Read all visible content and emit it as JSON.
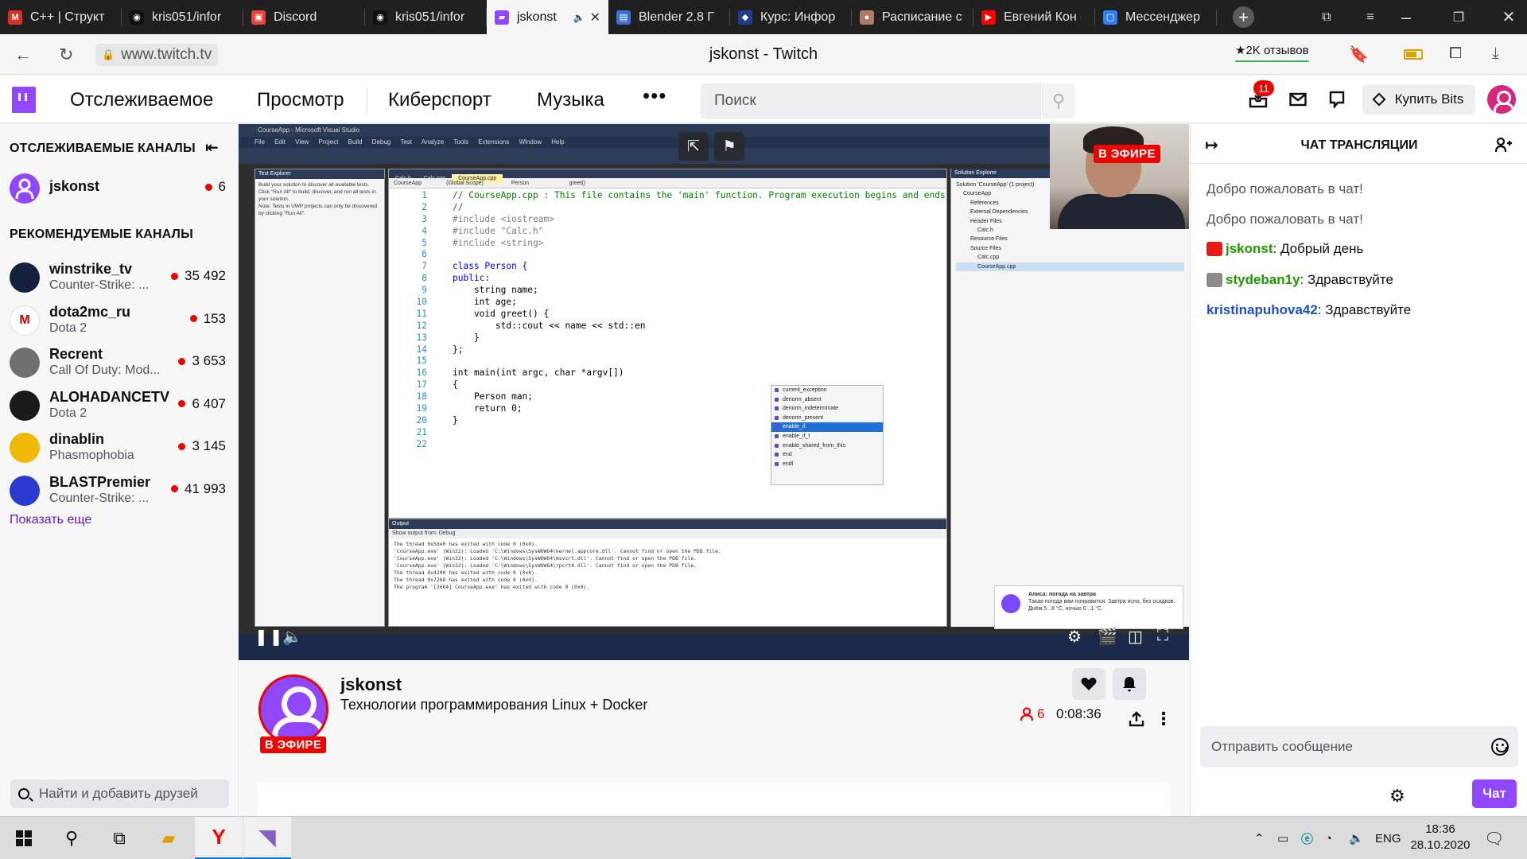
{
  "browser": {
    "tabs": [
      {
        "title": "C++ | Структ",
        "icon_color": "#d93025",
        "icon_char": "M",
        "active": false
      },
      {
        "title": "kris051/infor",
        "icon_color": "#111111",
        "icon_char": "◉",
        "active": false
      },
      {
        "title": "Discord",
        "icon_color": "#e8403a",
        "icon_char": "▣",
        "active": false
      },
      {
        "title": "kris051/infor",
        "icon_color": "#111111",
        "icon_char": "◉",
        "active": false
      },
      {
        "title": "jskonst",
        "icon_color": "#9147ff",
        "icon_char": "▰",
        "active": true
      },
      {
        "title": "Blender 2.8 Г",
        "icon_color": "#3a6fd8",
        "icon_char": "▤",
        "active": false
      },
      {
        "title": "Курс: Инфор",
        "icon_color": "#1f3d8c",
        "icon_char": "◆",
        "active": false
      },
      {
        "title": "Расписание с",
        "icon_color": "#b07a6a",
        "icon_char": "●",
        "active": false
      },
      {
        "title": "Евгений Кон",
        "icon_color": "#ff0000",
        "icon_char": "▶",
        "active": false
      },
      {
        "title": "Мессенджер",
        "icon_color": "#2d7ff9",
        "icon_char": "▢",
        "active": false
      }
    ],
    "url": "www.twitch.tv",
    "page_title": "jskonst - Twitch",
    "reviews": "★2K отзывов"
  },
  "twitch": {
    "nav": {
      "following": "Отслеживаемое",
      "browse": "Просмотр",
      "esports": "Киберспорт",
      "music": "Музыка",
      "more": "•••",
      "search_placeholder": "Поиск",
      "inbox_count": "11",
      "buy_bits": "Купить Bits"
    },
    "sidebar": {
      "followed_header": "ОТСЛЕЖИВАЕМЫЕ КАНАЛЫ",
      "followed": [
        {
          "name": "jskonst",
          "game": "",
          "viewers": "6",
          "avatar_color": "#9147ff"
        }
      ],
      "recommended_header": "РЕКОМЕНДУЕМЫЕ КАНАЛЫ",
      "recommended": [
        {
          "name": "winstrike_tv",
          "game": "Counter-Strike: ...",
          "viewers": "35 492",
          "avatar_color": "#14213d"
        },
        {
          "name": "dota2mc_ru",
          "game": "Dota 2",
          "viewers": "153",
          "avatar_color": "#ffffff"
        },
        {
          "name": "Recrent",
          "game": "Call Of Duty: Mod...",
          "viewers": "3 653",
          "avatar_color": "#6f6f6f"
        },
        {
          "name": "ALOHADANCETV",
          "game": "Dota 2",
          "viewers": "6 407",
          "avatar_color": "#1a1a1a"
        },
        {
          "name": "dinablin",
          "game": "Phasmophobia",
          "viewers": "3 145",
          "avatar_color": "#f2b807"
        },
        {
          "name": "BLASTPremier",
          "game": "Counter-Strike: ...",
          "viewers": "41 993",
          "avatar_color": "#2a3ad0"
        }
      ],
      "show_more": "Показать еще",
      "friends_search": "Найти и добавить друзей"
    },
    "player": {
      "live_badge": "В ЭФИРЕ",
      "vs_title": "CourseApp - Microsoft Visual Studio",
      "vs_menu": "File Edit View Project Build Debug Test Analyze Tools Extensions Window Help",
      "test_explorer_title": "Test Explorer",
      "test_explorer_text": "Build your solution to discover all available tests. Click \"Run All\" to build, discover, and run all tests in your solution.\nNote: Tests in UWP projects can only be discovered by clicking \"Run All\".",
      "editor_tabs": [
        "Calc.h",
        "Calc.cpp",
        "CourseApp.cpp"
      ],
      "editor_nav": "CourseApp                (Global Scope)                  Person                          greet()",
      "code_lines": [
        [
          "// CourseApp.cpp : This file contains the 'main' function. Program execution begins and ends there.",
          "cm"
        ],
        [
          "//",
          "cm"
        ],
        [
          "#include <iostream>",
          "pp"
        ],
        [
          "#include \"Calc.h\"",
          "pp"
        ],
        [
          "#include <string>",
          "pp"
        ],
        [
          "",
          ""
        ],
        [
          "class Person {",
          "kw"
        ],
        [
          "public:",
          "kw"
        ],
        [
          "    string name;",
          ""
        ],
        [
          "    int age;",
          ""
        ],
        [
          "    void greet() {",
          ""
        ],
        [
          "        std::cout << name << std::en",
          ""
        ],
        [
          "    }",
          ""
        ],
        [
          "};",
          ""
        ],
        [
          "",
          ""
        ],
        [
          "int main(int argc, char *argv[])",
          ""
        ],
        [
          "{",
          ""
        ],
        [
          "    Person man;",
          ""
        ],
        [
          "    return 0;",
          ""
        ],
        [
          "}",
          ""
        ],
        [
          "",
          ""
        ],
        [
          "",
          ""
        ]
      ],
      "intellisense": [
        "current_exception",
        "denorm_absent",
        "denorm_indeterminate",
        "denorm_present",
        "enable_if",
        "enable_if_t",
        "enable_shared_from_this",
        "end",
        "endl"
      ],
      "intellisense_selected": 4,
      "output_title": "Output",
      "output_source": "Show output from:  Debug",
      "output_lines": "The thread 0x5de0 has exited with code 0 (0x0).\n'CourseApp.exe' (Win32): Loaded 'C:\\Windows\\SysWOW64\\kernel.appcore.dll'. Cannot find or open the PDB file.\n'CourseApp.exe' (Win32): Loaded 'C:\\Windows\\SysWOW64\\msvcrt.dll'. Cannot find or open the PDB file.\n'CourseApp.exe' (Win32): Loaded 'C:\\Windows\\SysWOW64\\rpcrt4.dll'. Cannot find or open the PDB file.\nThe thread 0x4200 has exited with code 0 (0x0).\nThe thread 0x7268 has exited with code 0 (0x0).\nThe program '[2664] CourseApp.exe' has exited with code 0 (0x0).",
      "solution_title": "Solution Explorer",
      "solution_tree": [
        "Solution 'CourseApp' (1 project)",
        "CourseApp",
        "References",
        "External Dependencies",
        "Header Files",
        "Calc.h",
        "Resource Files",
        "Source Files",
        "Calc.cpp",
        "CourseApp.cpp"
      ],
      "notification_title": "Алиса: погода на завтра",
      "notification_body": "Такая погода вам понравится. Завтра ясно, без осадков. Днём 5...8 °C, ночью 0...1 °C"
    },
    "stream": {
      "channel": "jskonst",
      "title": "Технологии программирования Linux + Docker",
      "live_tag": "В ЭФИРЕ",
      "viewers": "6",
      "uptime": "0:08:36"
    },
    "chat": {
      "header": "ЧАТ ТРАНСЛЯЦИИ",
      "messages": [
        {
          "user": "",
          "text": "Добро пожаловать в чат!",
          "color": "#53535f",
          "badge": ""
        },
        {
          "user": "",
          "text": "Добро пожаловать в чат!",
          "color": "#53535f",
          "badge": ""
        },
        {
          "user": "jskonst",
          "text": ": Добрый день",
          "color": "#1e9900",
          "badge": "#e91916"
        },
        {
          "user": "stydeban1y",
          "text": ": Здравствуйте",
          "color": "#1e9900",
          "badge": "#8a8a8a"
        },
        {
          "user": "kristinapuhova42",
          "text": ": Здравствуйте",
          "color": "#1f4fc7",
          "badge": ""
        }
      ],
      "input_placeholder": "Отправить сообщение",
      "send_label": "Чат"
    }
  },
  "taskbar": {
    "lang": "ENG",
    "time": "18:36",
    "date": "28.10.2020"
  }
}
